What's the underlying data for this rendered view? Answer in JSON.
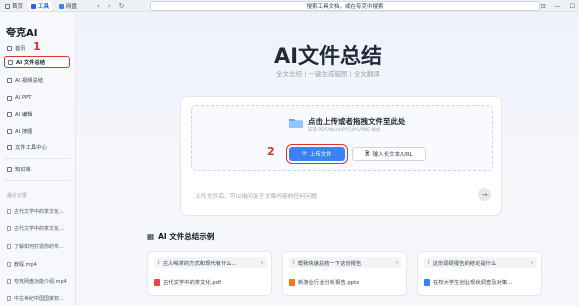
{
  "topbar": {
    "tabs": [
      {
        "label": "首页",
        "icon": "home-icon"
      },
      {
        "label": "工具",
        "icon": "tools-icon"
      },
      {
        "label": "网盘",
        "icon": "cloud-drive-icon"
      }
    ],
    "search_placeholder": "搜索工具文档，或在夸克中搜索",
    "accent": "#2563eb"
  },
  "sidebar": {
    "logo": "夸克AI",
    "items": [
      {
        "label": "首页",
        "icon": "home-icon"
      },
      {
        "label": "AI 文件总结",
        "icon": "file-summary-icon"
      },
      {
        "label": "AI 视频总结",
        "icon": "video-summary-icon"
      },
      {
        "label": "AI PPT",
        "icon": "ppt-icon"
      },
      {
        "label": "AI 编辑",
        "icon": "edit-icon"
      },
      {
        "label": "AI 搜题",
        "icon": "search-question-icon"
      },
      {
        "label": "文件工具中心",
        "icon": "file-tools-icon"
      },
      {
        "label": "知识库",
        "icon": "knowledge-base-icon"
      }
    ],
    "recent_title": "最近记录",
    "recent": [
      "古代文学中的茶文化...",
      "古代文学中的茶文化...",
      "了解如何打造你的专...",
      "教程.mp4",
      "夸克网盘功能介绍.mp4",
      "中古世纪中国国家权..."
    ]
  },
  "annotations": {
    "one": "1",
    "two": "2"
  },
  "main": {
    "title": "AI文件总结",
    "subtitle": "全文总结 | 一键生成脑图 | 全文翻译",
    "upload": {
      "title": "点击上传或者拖拽文件至此处",
      "formats": "支持 PDF/Word/PPT/JPG/PNG 格式",
      "upload_button": "上传文件",
      "text_button": "输入长文本/URL"
    },
    "prompt_placeholder": "上传文件后，可以询问关于文章内容的任何问题",
    "examples_title": "AI 文件总结示例",
    "examples": [
      {
        "question": "古人喝茶的方式和现代有什么...",
        "file": "古代文学中的茶文化.pdf",
        "file_color": "#ef4444"
      },
      {
        "question": "帮我快速总结一下这份报告",
        "file": "新游业行业分析报告.pptx",
        "file_color": "#f97316"
      },
      {
        "question": "这份调研报告的结论是什么",
        "file": "在校大学生创业现状调查及对策...",
        "file_color": "#3b82f6"
      }
    ]
  }
}
